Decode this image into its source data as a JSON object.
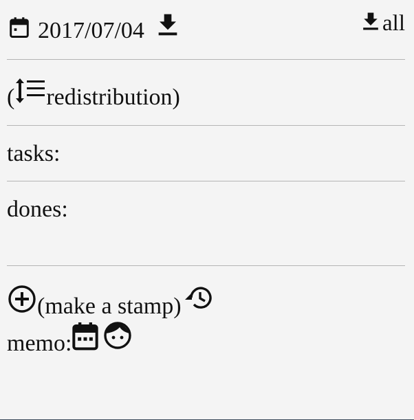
{
  "header": {
    "date": "2017/07/04",
    "all_label": "all",
    "calendar_icon": "calendar-icon",
    "download_icon": "download-icon"
  },
  "redistribution": {
    "open_paren": "(",
    "label": "redistribution",
    "close_paren": ")",
    "icon": "sort-lines-icon"
  },
  "tasks": {
    "label": "tasks:"
  },
  "dones": {
    "label": "dones:"
  },
  "stamp": {
    "label": "(make a stamp)",
    "add_icon": "add-circle-icon",
    "history_icon": "history-icon"
  },
  "memo": {
    "label": "memo:",
    "calendar_icon": "calendar-icon",
    "face_icon": "face-icon"
  },
  "colors": {
    "background": "#f4f4f4",
    "text": "#111111",
    "divider": "#b4b4b4"
  }
}
